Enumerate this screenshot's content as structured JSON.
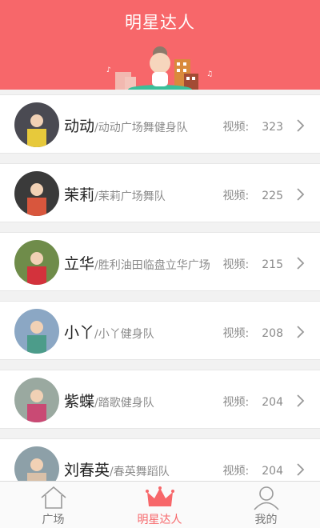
{
  "header": {
    "title": "明星达人"
  },
  "list": [
    {
      "name": "动动",
      "team": "/动动广场舞健身队",
      "count_label": "视频:",
      "count": "323",
      "colors": [
        "#4a4a52",
        "#e7c93b"
      ]
    },
    {
      "name": "茉莉",
      "team": "/茉莉广场舞队",
      "count_label": "视频:",
      "count": "225",
      "colors": [
        "#3a3a3a",
        "#d8563d"
      ]
    },
    {
      "name": "立华",
      "team": "/胜利油田临盘立华广场",
      "count_label": "视频:",
      "count": "215",
      "colors": [
        "#6f8c4a",
        "#d3323c"
      ]
    },
    {
      "name": "小丫",
      "team": "/小丫健身队",
      "count_label": "视频:",
      "count": "208",
      "colors": [
        "#8ba7c4",
        "#4c9c8a"
      ]
    },
    {
      "name": "紫蝶",
      "team": "/踏歌健身队",
      "count_label": "视频:",
      "count": "204",
      "colors": [
        "#9aa9a0",
        "#c94a74"
      ]
    },
    {
      "name": "刘春英",
      "team": "/春英舞蹈队",
      "count_label": "视频:",
      "count": "204",
      "colors": [
        "#8da0a8",
        "#d9c0a8"
      ]
    }
  ],
  "tabs": [
    {
      "label": "广场",
      "icon": "house-icon"
    },
    {
      "label": "明星达人",
      "icon": "crown-icon"
    },
    {
      "label": "我的",
      "icon": "person-icon"
    }
  ],
  "colors": {
    "accent": "#f7676a"
  }
}
